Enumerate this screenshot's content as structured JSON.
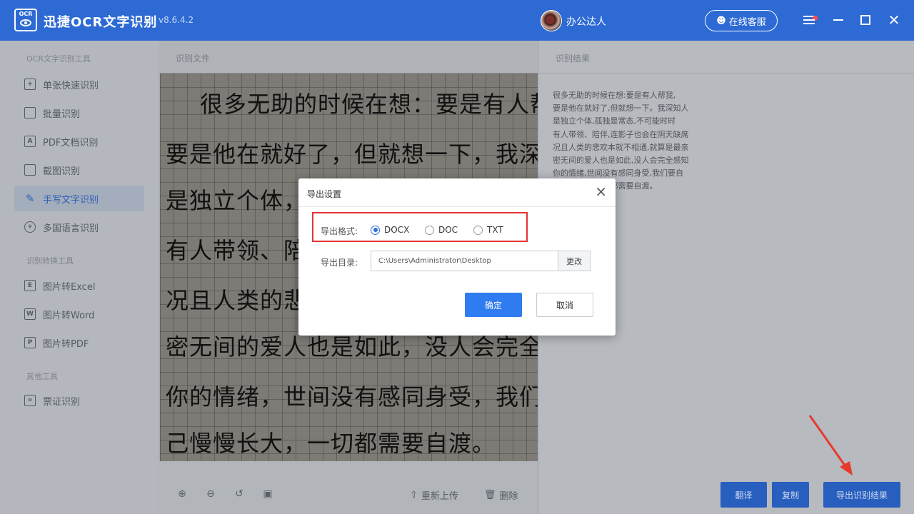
{
  "app": {
    "logo_text": "OCR",
    "title": "迅捷OCR文字识别",
    "version": "v8.6.4.2",
    "username": "办公达人",
    "service_label": "在线客服"
  },
  "sidebar": {
    "sections": [
      "OCR文字识别工具",
      "识别转换工具",
      "其他工具"
    ],
    "items": [
      {
        "label": "单张快速识别",
        "icon": "single-scan-icon"
      },
      {
        "label": "批量识别",
        "icon": "batch-icon"
      },
      {
        "label": "PDF文档识别",
        "icon": "pdf-doc-icon"
      },
      {
        "label": "截图识别",
        "icon": "screenshot-icon"
      },
      {
        "label": "手写文字识别",
        "icon": "handwriting-icon"
      },
      {
        "label": "多国语言识别",
        "icon": "globe-icon"
      },
      {
        "label": "图片转Excel",
        "icon": "excel-icon"
      },
      {
        "label": "图片转Word",
        "icon": "word-icon"
      },
      {
        "label": "图片转PDF",
        "icon": "pdf-icon"
      },
      {
        "label": "票证识别",
        "icon": "ticket-icon"
      }
    ],
    "active_item": "手写文字识别"
  },
  "center": {
    "title": "识别文件",
    "handwriting_lines": [
      "很多无助的时候在想：要是有人帮我",
      "要是他在就好了，但就想一下，我深知人",
      "是独立个体，孤",
      "有人带领、陪伴",
      "况且人类的悲欢",
      "密无间的爱人也是如此，没人会完全感知",
      "你的情绪，世间没有感同身受，我们要自",
      "己慢慢长大，一切都需要自渡。"
    ],
    "reupload_label": "重新上传",
    "delete_label": "删除"
  },
  "result": {
    "title": "识别结果",
    "lines": [
      "很多无助的时候在想:要是有人帮我,",
      "要是他在就好了,但就想一下。我深知人",
      "是独立个体,孤独是常态,不可能时时",
      "有人带领、陪伴,连影子也会在阴天缺席",
      "况且人类的悲欢本就不相通,就算是最亲",
      "密无间的爱人也是如此,没人会完全感知",
      "你的情绪,世间没有感同身受,我们要自",
      "己慢慢长大,一切都需要自渡。"
    ],
    "buttons": {
      "translate": "翻译",
      "copy": "复制",
      "export": "导出识别结果"
    }
  },
  "dialog": {
    "title": "导出设置",
    "format_label": "导出格式:",
    "formats": [
      "DOCX",
      "DOC",
      "TXT"
    ],
    "selected_format": "DOCX",
    "dir_label": "导出目录:",
    "dir_value": "C:\\Users\\Administrator\\Desktop",
    "change_label": "更改",
    "ok_label": "确定",
    "cancel_label": "取消"
  },
  "colors": {
    "titlebar": "#2d6ad4",
    "accent": "#2f7bf0",
    "highlight_box": "#e23434",
    "arrow": "#e8392c"
  }
}
